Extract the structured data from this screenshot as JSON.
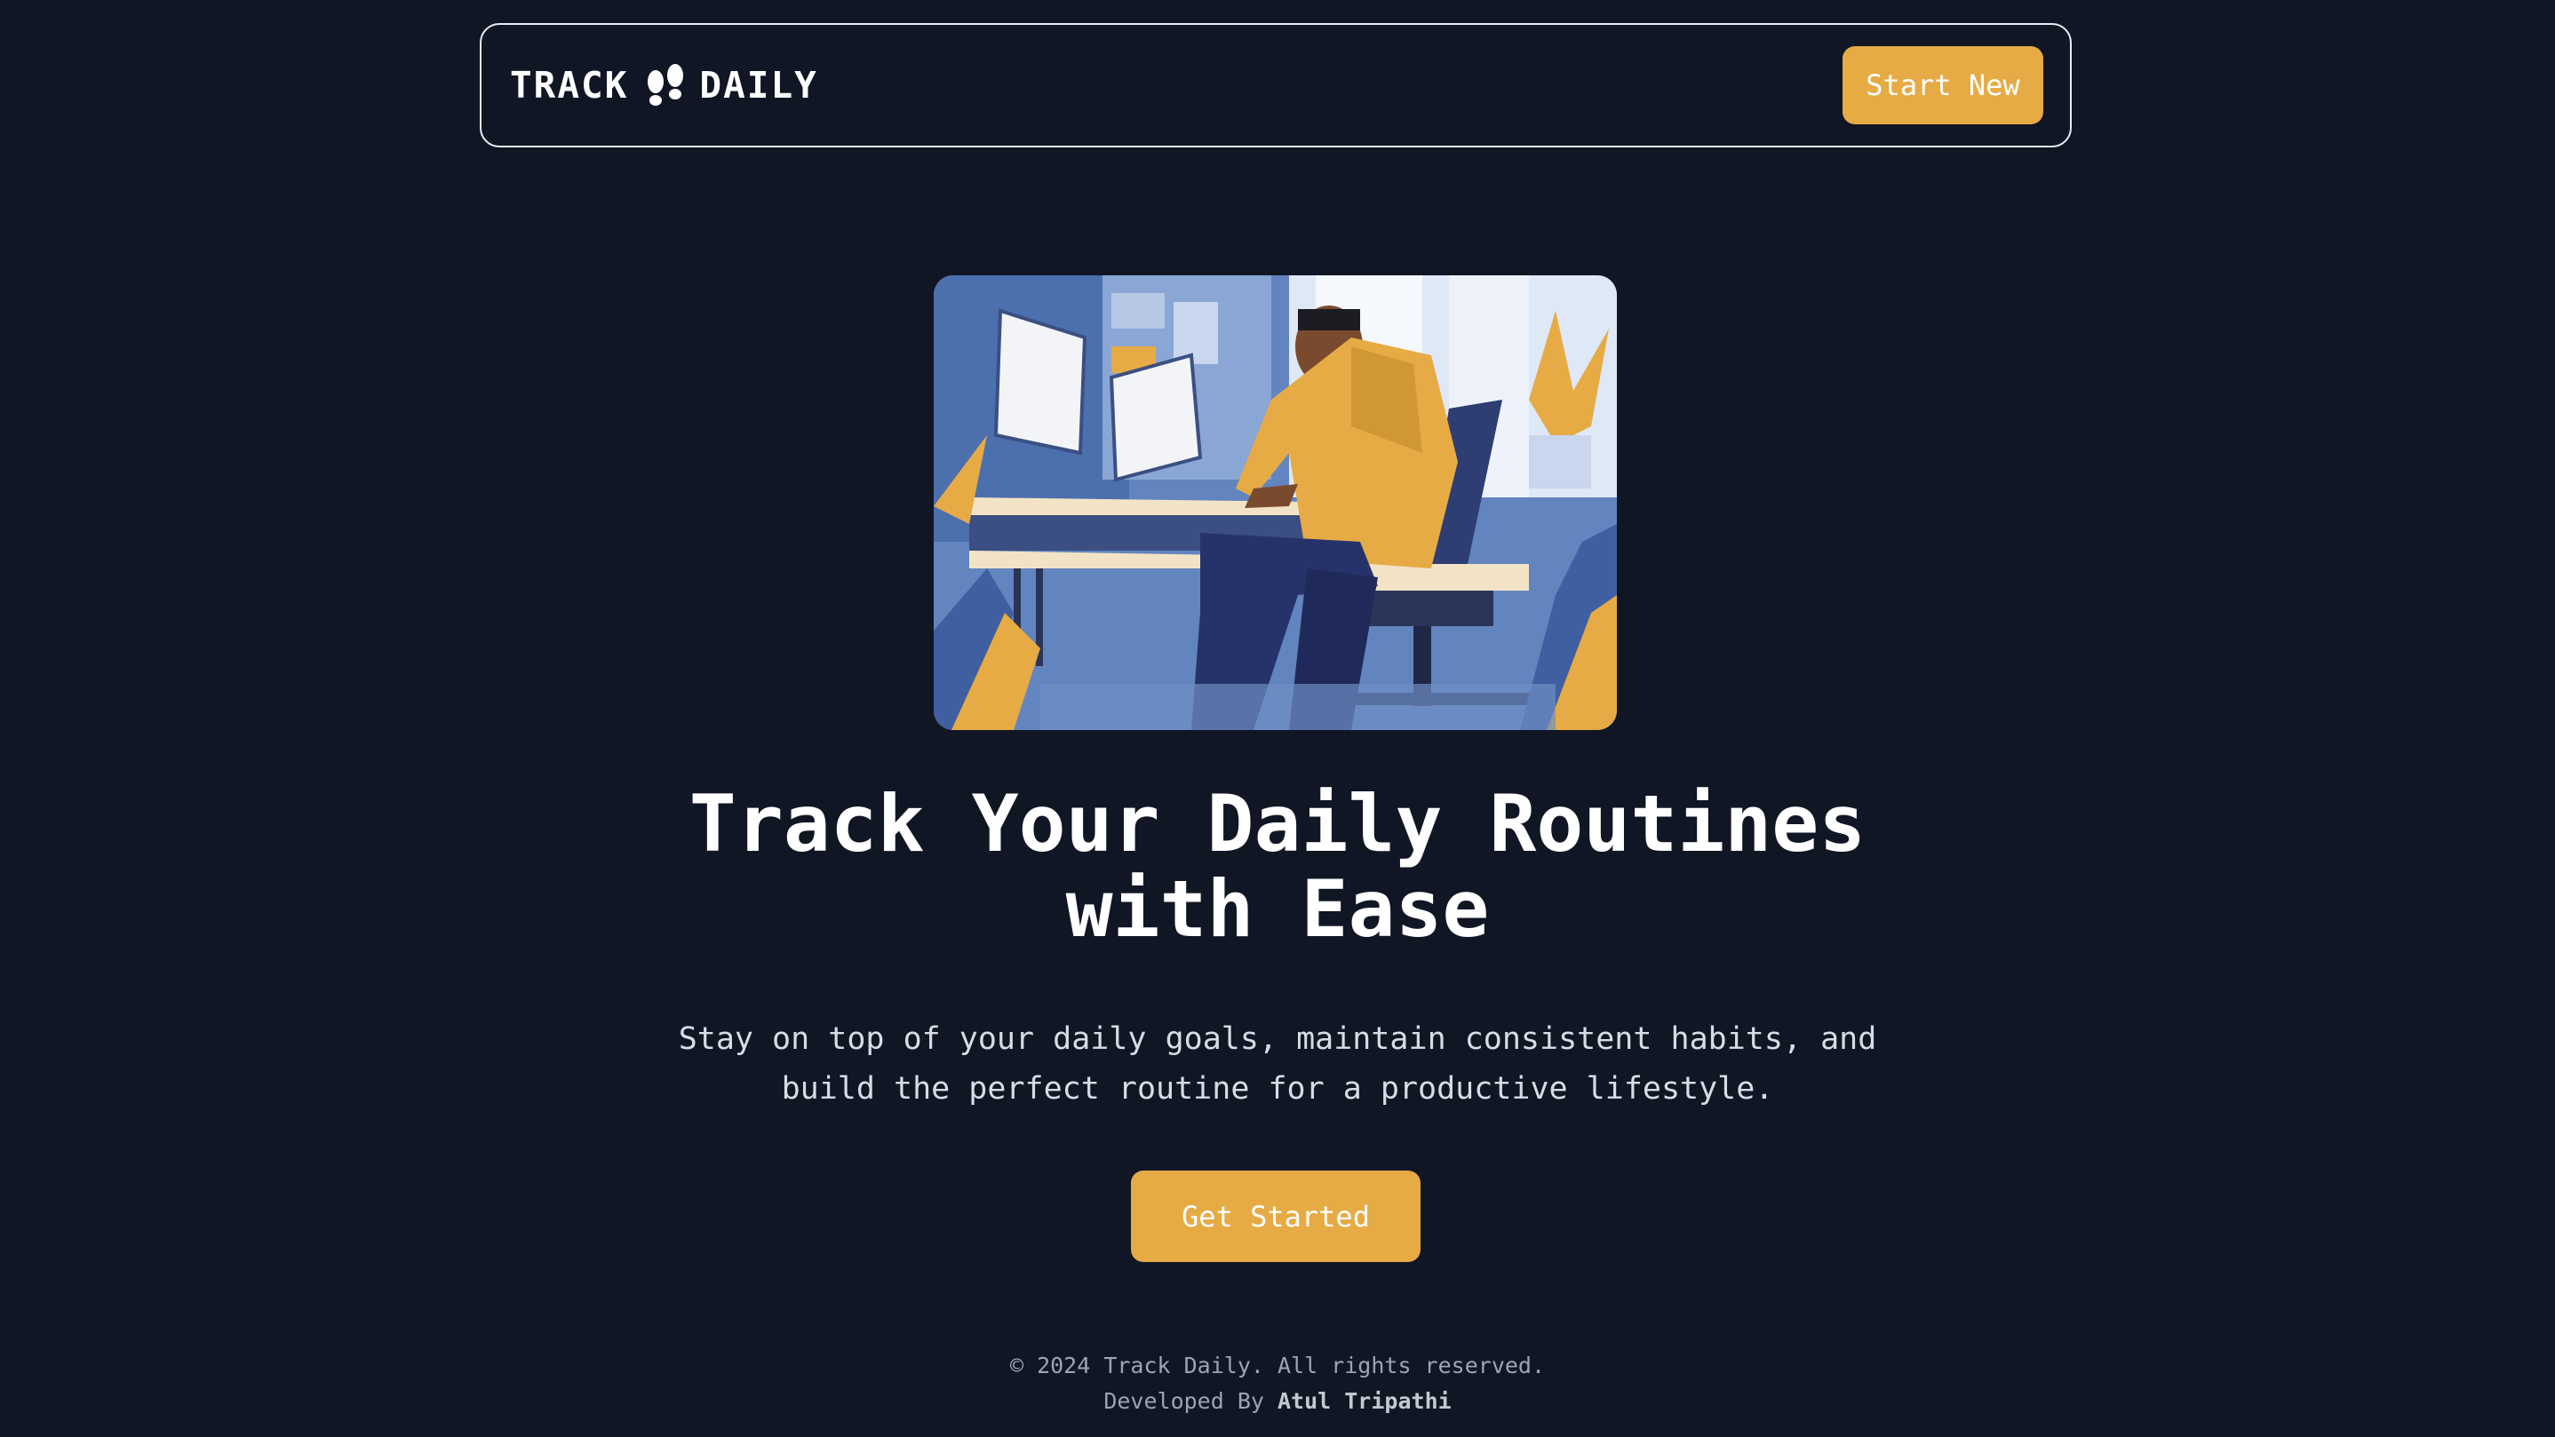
{
  "header": {
    "logo_left": "TRACK",
    "logo_right": "DAILY",
    "logo_icon": "footprints-icon",
    "start_button": "Start New"
  },
  "hero": {
    "image_icon": "person-at-desk-illustration",
    "title_line1": "Track Your Daily Routines",
    "title_line2": "with Ease",
    "subtitle_line1": "Stay on top of your daily goals, maintain consistent habits, and",
    "subtitle_line2": "build the perfect routine for a productive lifestyle.",
    "cta_button": "Get Started"
  },
  "footer": {
    "copyright": "© 2024 Track Daily. All rights reserved.",
    "developed_by": "Developed By",
    "author": "Atul Tripathi"
  },
  "colors": {
    "background": "#111625",
    "accent": "#e6ab45",
    "text": "#ffffff",
    "muted": "#9ea4b0"
  }
}
